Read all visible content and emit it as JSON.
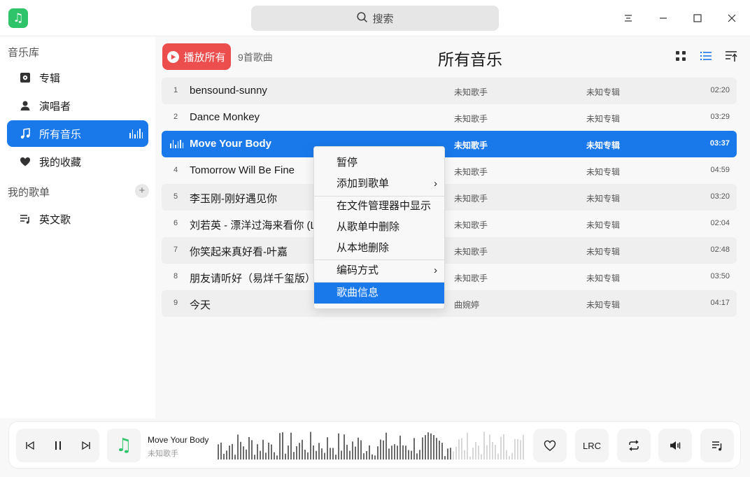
{
  "search": {
    "label": "搜索"
  },
  "sidebar": {
    "library_header": "音乐库",
    "items": [
      {
        "label": "专辑",
        "icon": "album-icon"
      },
      {
        "label": "演唱者",
        "icon": "singer-icon"
      },
      {
        "label": "所有音乐",
        "icon": "music-note-icon"
      },
      {
        "label": "我的收藏",
        "icon": "heart-icon"
      }
    ],
    "playlists_header": "我的歌单",
    "add_label": "+",
    "playlists": [
      {
        "label": "英文歌",
        "icon": "playlist-icon"
      }
    ]
  },
  "header": {
    "play_all": "播放所有",
    "song_count": "9首歌曲",
    "title": "所有音乐"
  },
  "songs": [
    {
      "num": "1",
      "title": "bensound-sunny",
      "artist": "未知歌手",
      "album": "未知专辑",
      "duration": "02:20"
    },
    {
      "num": "2",
      "title": "Dance Monkey",
      "artist": "未知歌手",
      "album": "未知专辑",
      "duration": "03:29"
    },
    {
      "num": "3",
      "title": "Move Your Body",
      "artist": "未知歌手",
      "album": "未知专辑",
      "duration": "03:37",
      "playing": true
    },
    {
      "num": "4",
      "title": "Tomorrow Will Be Fine",
      "artist": "未知歌手",
      "album": "未知专辑",
      "duration": "04:59"
    },
    {
      "num": "5",
      "title": "李玉刚-刚好遇见你",
      "artist": "未知歌手",
      "album": "未知专辑",
      "duration": "03:20"
    },
    {
      "num": "6",
      "title": "刘若英 - 漂洋过海来看你 (Live)",
      "artist": "未知歌手",
      "album": "未知专辑",
      "duration": "02:04"
    },
    {
      "num": "7",
      "title": "你笑起来真好看-叶嘉",
      "artist": "未知歌手",
      "album": "未知专辑",
      "duration": "02:48"
    },
    {
      "num": "8",
      "title": "朋友请听好（易烊千玺版）",
      "artist": "未知歌手",
      "album": "未知专辑",
      "duration": "03:50"
    },
    {
      "num": "9",
      "title": "今天",
      "artist": "曲婉婷",
      "album": "未知专辑",
      "duration": "04:17"
    }
  ],
  "context_menu": {
    "pause": "暂停",
    "add_to_playlist": "添加到歌单",
    "show_in_file_manager": "在文件管理器中显示",
    "remove_from_playlist": "从歌单中删除",
    "delete_local": "从本地删除",
    "encoding": "编码方式",
    "song_info": "歌曲信息",
    "submenu_arrow": "›"
  },
  "player": {
    "title": "Move Your Body",
    "artist": "未知歌手",
    "lrc_label": "LRC",
    "progress": 0.76
  },
  "colors": {
    "accent": "#1a79ea",
    "play_all": "#ec4d4d",
    "app_green": "#2fc36a"
  }
}
